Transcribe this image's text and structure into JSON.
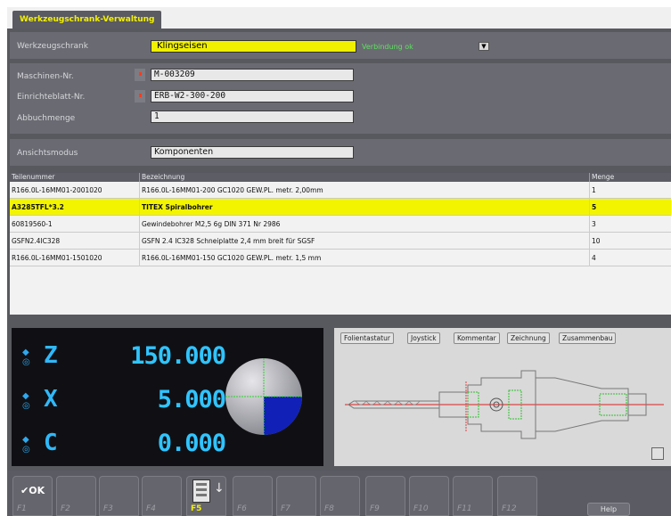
{
  "tab": {
    "label": "Werkzeugschrank-Verwaltung"
  },
  "cabinet": {
    "label": "Werkzeugschrank",
    "value": "Klingseisen",
    "status": "Verbindung ok"
  },
  "machine": {
    "machine_no_label": "Maschinen-Nr.",
    "machine_no_value": "M-003209",
    "setup_sheet_label": "Einrichteblatt-Nr.",
    "setup_sheet_value": "ERB-W2-300-200",
    "quantity_label": "Abbuchmenge",
    "quantity_value": "1"
  },
  "view": {
    "label": "Ansichtsmodus",
    "value": "Komponenten"
  },
  "table": {
    "columns": [
      "Teilenummer",
      "Bezeichnung",
      "Menge"
    ],
    "rows": [
      [
        "R166.0L-16MM01-2001020",
        "R166.0L-16MM01-200 GC1020 GEW.PL. metr. 2,00mm",
        "1"
      ],
      [
        "A3285TFL*3.2",
        "TITEX Spiralbohrer",
        "5"
      ],
      [
        "60819560-1",
        "Gewindebohrer M2,5 6g DIN 371 Nr 2986",
        "3"
      ],
      [
        "GSFN2.4IC328",
        "GSFN 2.4 IC328 Schneiplatte 2,4 mm breit für SGSF",
        "10"
      ],
      [
        "R166.0L-16MM01-1501020",
        "R166.0L-16MM01-150 GC1020 GEW.PL. metr. 1,5 mm",
        "4"
      ]
    ],
    "selected_row": 1
  },
  "dro": {
    "axes": [
      {
        "letter": "Z",
        "value": "150.000"
      },
      {
        "letter": "X",
        "value": "5.000"
      },
      {
        "letter": "C",
        "value": "0.000"
      }
    ]
  },
  "drawing_tabs": [
    "Folientastatur",
    "Joystick",
    "Kommentar",
    "Zeichnung",
    "Zusammenbau"
  ],
  "fkeys": [
    {
      "label": "F1",
      "icon": "ok-check-icon",
      "icon_text": "OK"
    },
    {
      "label": "F2"
    },
    {
      "label": "F3"
    },
    {
      "label": "F4"
    },
    {
      "label": "F5",
      "icon": "tool-cabinet-icon",
      "active": true
    },
    {
      "label": "F6"
    },
    {
      "label": "F7"
    },
    {
      "label": "F8"
    },
    {
      "label": "F9"
    },
    {
      "label": "F10"
    },
    {
      "label": "F11"
    },
    {
      "label": "F12"
    }
  ],
  "help": {
    "label": "Help"
  },
  "colors": {
    "accent_yellow": "#f3f000",
    "background": "#58585f",
    "dro_blue": "#30c4ff",
    "status_green": "#5fe060"
  }
}
